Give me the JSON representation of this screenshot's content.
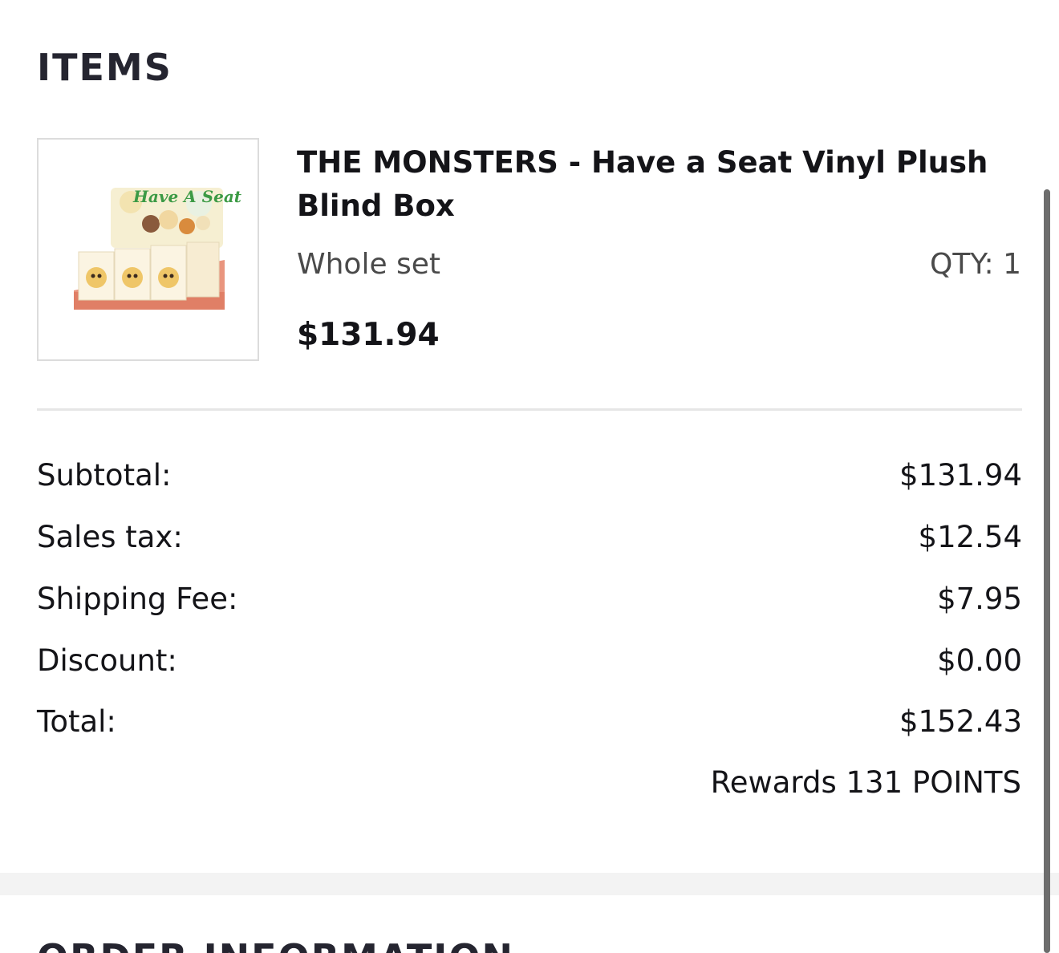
{
  "items_section": {
    "title": "ITEMS"
  },
  "product": {
    "image_alt": "THE MONSTERS Have a Seat blind box display",
    "image_text": "Have A Seat",
    "name": "THE MONSTERS - Have a Seat Vinyl Plush Blind Box",
    "variant": "Whole set",
    "qty": "QTY: 1",
    "price": "$131.94"
  },
  "summary": {
    "rows": [
      {
        "label": "Subtotal:",
        "value": "$131.94"
      },
      {
        "label": "Sales tax:",
        "value": "$12.54"
      },
      {
        "label": "Shipping Fee:",
        "value": "$7.95"
      },
      {
        "label": "Discount:",
        "value": "$0.00"
      },
      {
        "label": "Total:",
        "value": "$152.43"
      }
    ],
    "rewards": "Rewards 131 POINTS"
  },
  "next_section": {
    "title": "ORDER INFORMATION"
  },
  "colors": {
    "text": "#141418",
    "heading": "#252530",
    "muted": "#4a4a4a",
    "divider": "#e6e6e6",
    "band": "#f3f3f3",
    "box_salmon": "#e9957e",
    "logo_green": "#3c9a45"
  }
}
